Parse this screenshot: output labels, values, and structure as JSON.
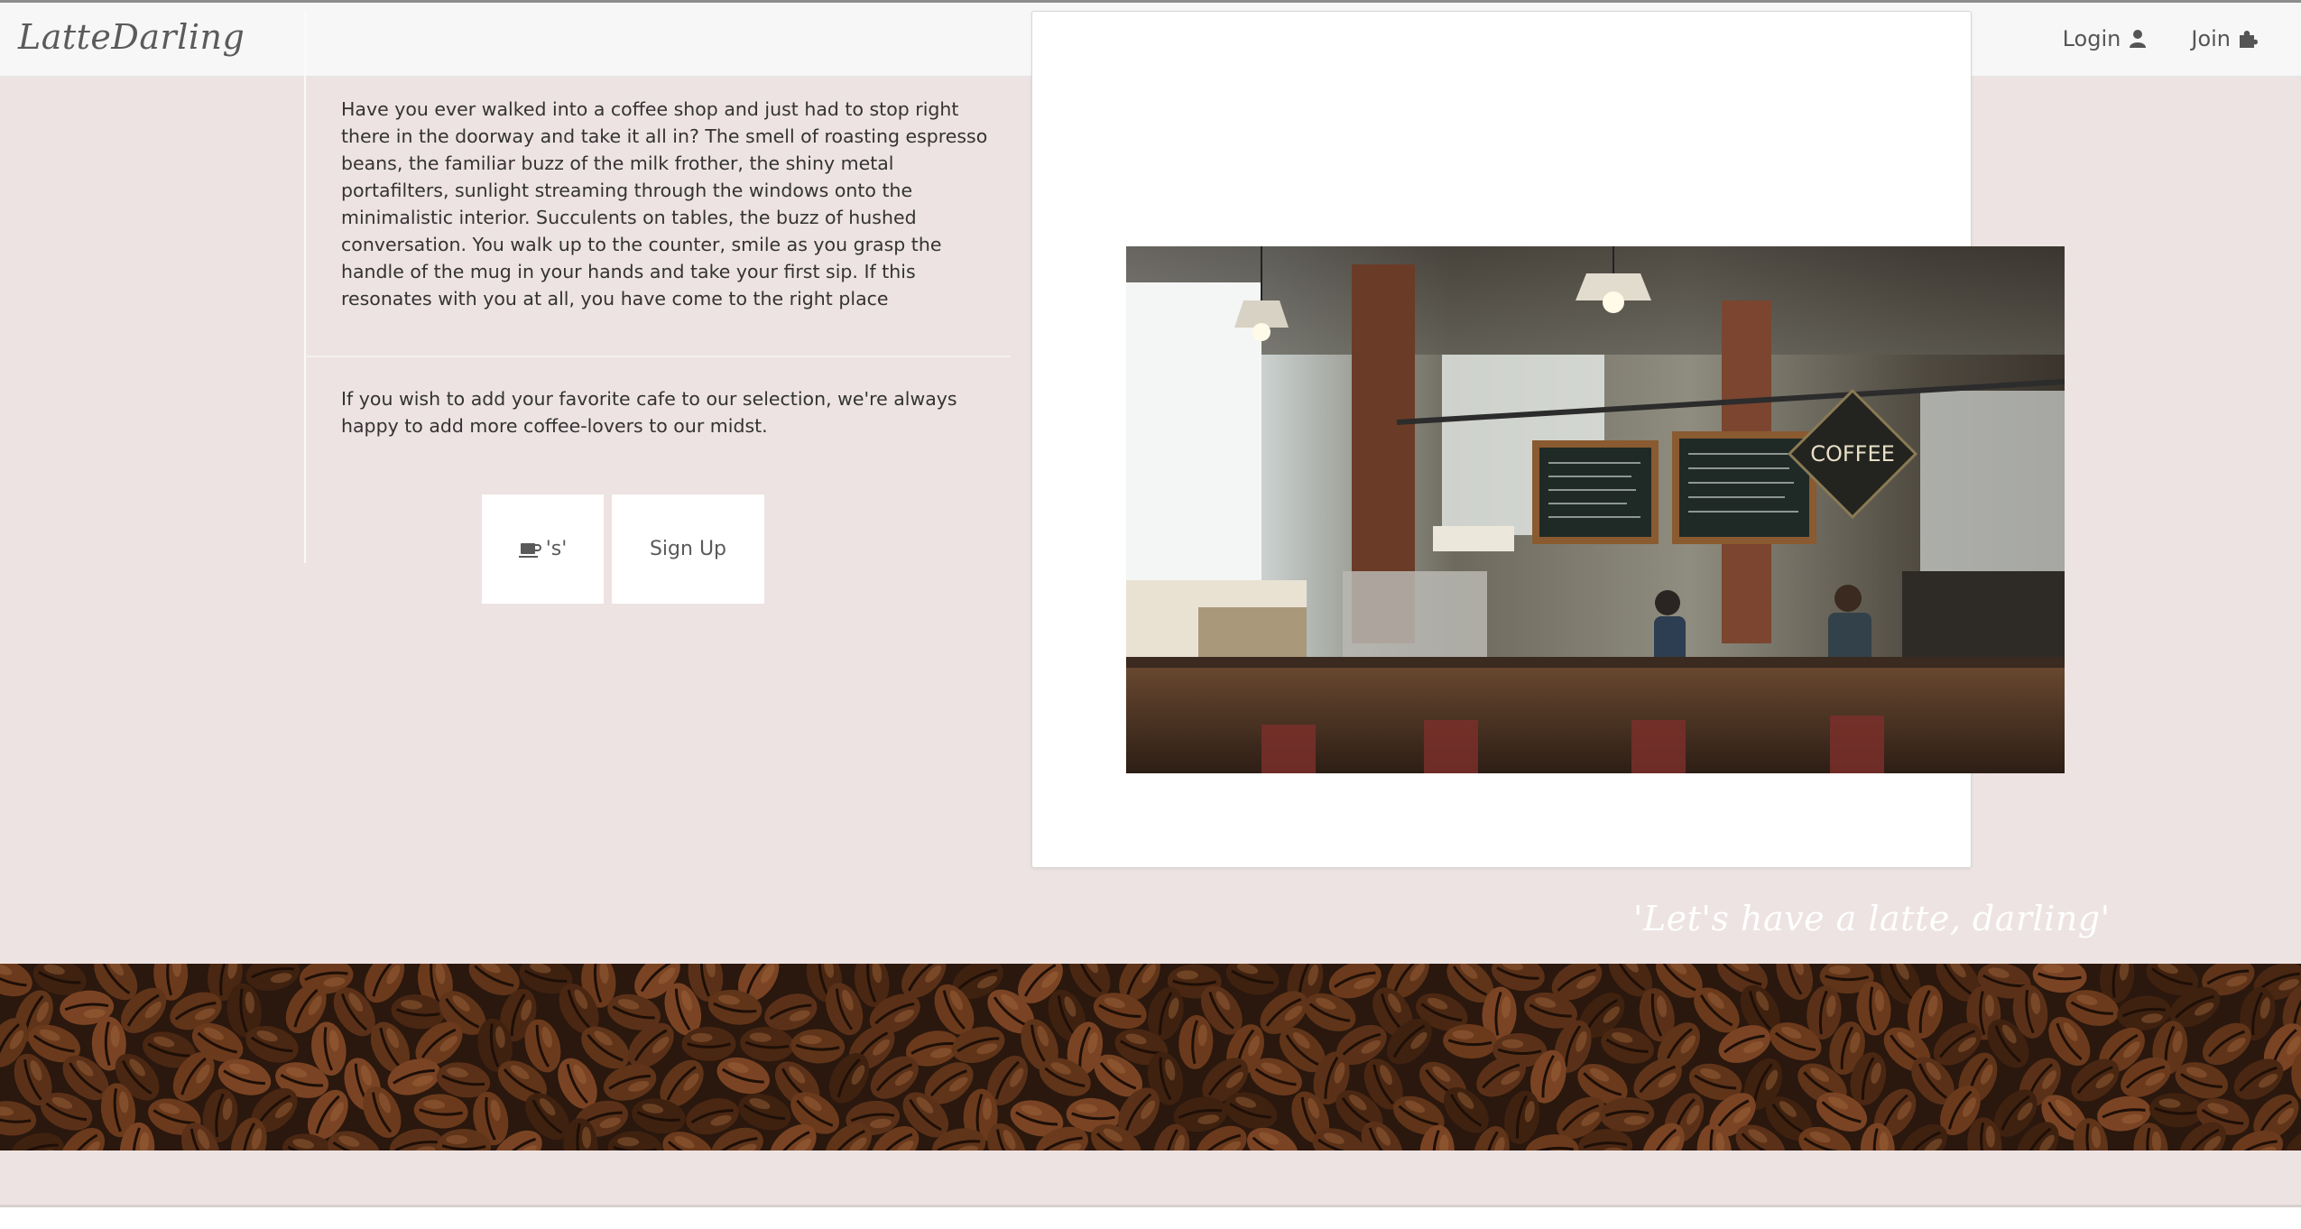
{
  "brand": "LatteDarling",
  "nav": {
    "login_label": "Login",
    "join_label": "Join"
  },
  "content": {
    "intro": "Have you ever walked into a coffee shop and just had to stop right there in the doorway and take it all in? The smell of roasting espresso beans, the familiar buzz of the milk frother, the shiny metal portafilters, sunlight streaming through the windows onto the minimalistic interior. Succulents on tables, the buzz of hushed conversation. You walk up to the counter, smile as you grasp the handle of the mug in your hands and take your first sip. If this resonates with you at all, you have come to the right place",
    "cta": "If you wish to add your favorite cafe to our selection, we're always happy to add more coffee-lovers to our midst."
  },
  "buttons": {
    "cafes_label": "'s'",
    "signup_label": "Sign Up"
  },
  "tagline": "'Let's have a latte, darling'",
  "icons": {
    "login": "user-icon",
    "join": "puzzle-piece-icon",
    "cafes": "coffee-cup-icon"
  },
  "colors": {
    "background": "#ede3e2",
    "navbar": "#f7f7f7",
    "card": "#ffffff",
    "tagline": "#ffffff"
  }
}
